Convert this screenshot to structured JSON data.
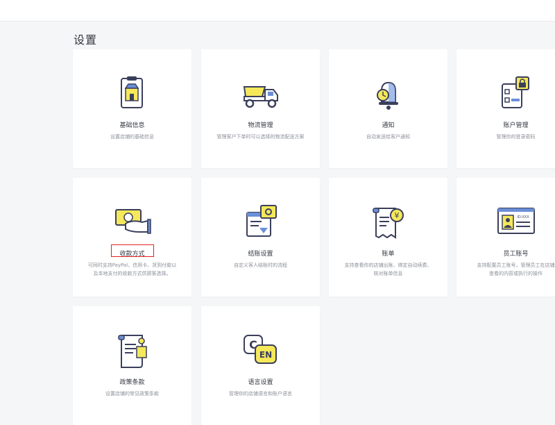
{
  "page": {
    "title": "设置"
  },
  "colors": {
    "accent_yellow": "#f5e85a",
    "icon_stroke": "#3a3f5c",
    "icon_blue": "#6a8fd8",
    "highlight_red": "#e02020"
  },
  "cards": [
    {
      "title": "基础信息",
      "desc": "设置店铺的基础信息",
      "icon": "store-clipboard-icon"
    },
    {
      "title": "物流管理",
      "desc": "管理客户下单时可以选择的物流配送方案",
      "icon": "dump-truck-icon"
    },
    {
      "title": "通知",
      "desc": "自动发送给客户通知",
      "icon": "bell-clock-icon"
    },
    {
      "title": "账户管理",
      "desc": "管理你的登录密码",
      "icon": "account-lock-icon"
    },
    {
      "title": "收款方式",
      "desc": "可同时支持PayPal、信用卡、货到付款以\n及本地支付的收款方式供顾客选择。",
      "icon": "hand-cash-icon"
    },
    {
      "title": "结账设置",
      "desc": "自定义客人结账时的流程",
      "icon": "checkout-gear-icon"
    },
    {
      "title": "账单",
      "desc": "支持查看你的店铺出账、绑定自动续费、\n核对账单信息",
      "icon": "bill-yen-icon"
    },
    {
      "title": "员工账号",
      "desc": "支持配置员工账号，管理员工在店铺\n查看的内容或执行的操作",
      "icon": "staff-badge-icon"
    },
    {
      "title": "政策条款",
      "desc": "设置店铺的常见政策条款",
      "icon": "policy-scroll-icon"
    },
    {
      "title": "语言设置",
      "desc": "管理你的店铺语言和账户语言",
      "icon": "language-cen-icon"
    }
  ],
  "language_icon": {
    "c": "C",
    "en": "EN"
  },
  "staff_icon_text": "ID:XXX",
  "bill_icon_symbol": "¥"
}
